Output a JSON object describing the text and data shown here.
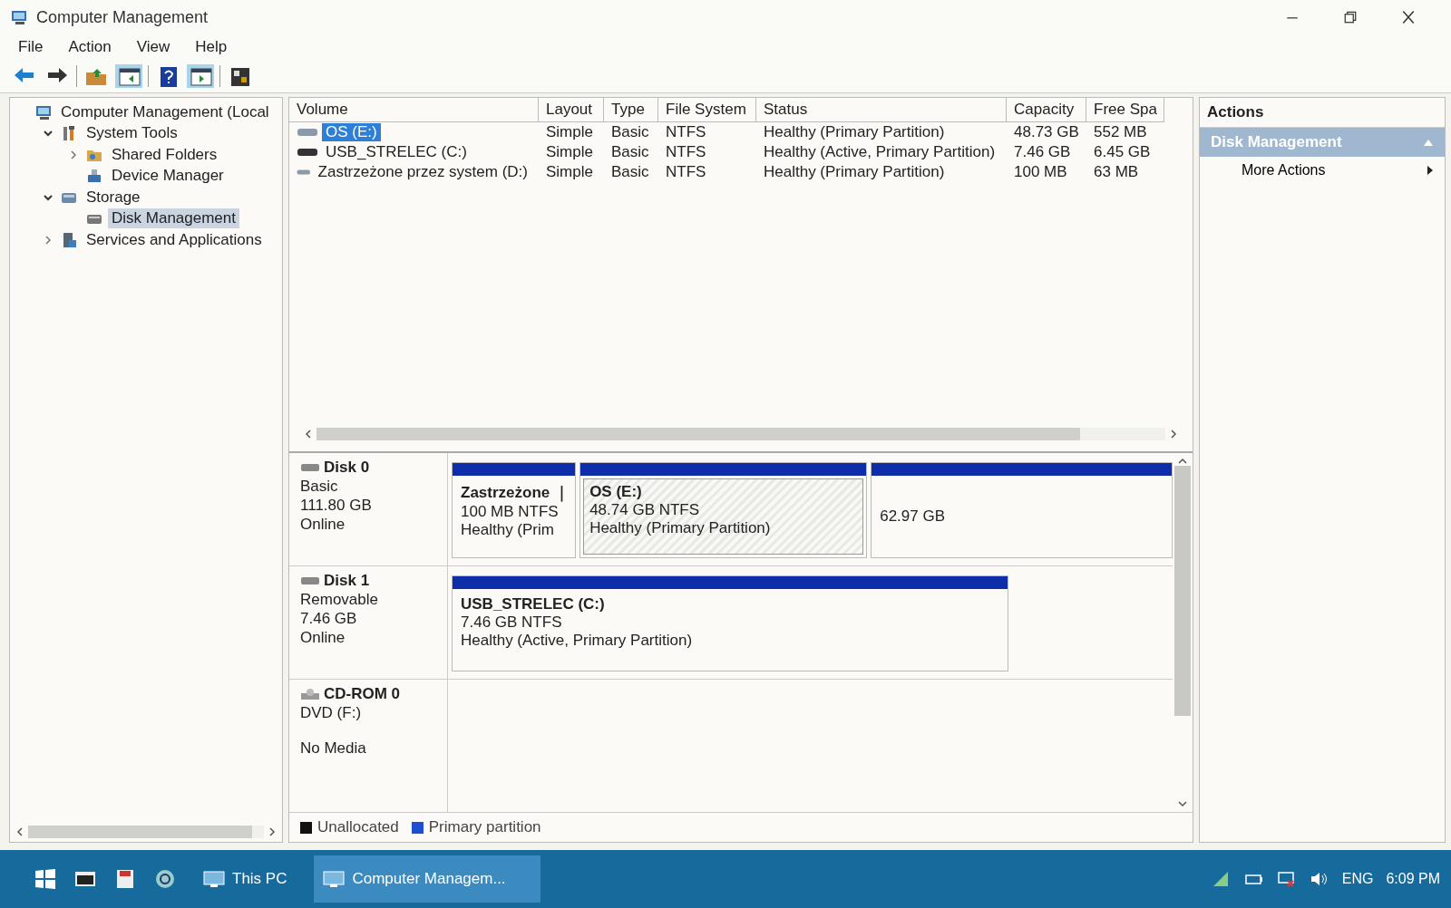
{
  "window": {
    "title": "Computer Management"
  },
  "menu": [
    "File",
    "Action",
    "View",
    "Help"
  ],
  "tree": [
    {
      "label": "Computer Management (Local",
      "selected": false,
      "children": [
        {
          "label": "System Tools",
          "expanded": true,
          "selected": false,
          "children": [
            {
              "label": "Shared Folders",
              "expanded": false,
              "selected": false
            },
            {
              "label": "Device Manager",
              "selected": false
            }
          ]
        },
        {
          "label": "Storage",
          "expanded": true,
          "selected": false,
          "children": [
            {
              "label": "Disk Management",
              "selected": true
            }
          ]
        },
        {
          "label": "Services and Applications",
          "expanded": false,
          "selected": false
        }
      ]
    }
  ],
  "volumes": {
    "columns": [
      "Volume",
      "Layout",
      "Type",
      "File System",
      "Status",
      "Capacity",
      "Free Spa"
    ],
    "rows": [
      {
        "selected": true,
        "cells": [
          "OS (E:)",
          "Simple",
          "Basic",
          "NTFS",
          "Healthy (Primary Partition)",
          "48.73 GB",
          "552 MB"
        ]
      },
      {
        "selected": false,
        "cells": [
          "USB_STRELEC (C:)",
          "Simple",
          "Basic",
          "NTFS",
          "Healthy (Active, Primary Partition)",
          "7.46 GB",
          "6.45 GB"
        ]
      },
      {
        "selected": false,
        "cells": [
          "Zastrzeżone przez system (D:)",
          "Simple",
          "Basic",
          "NTFS",
          "Healthy (Primary Partition)",
          "100 MB",
          "63 MB"
        ]
      }
    ]
  },
  "disks": [
    {
      "name": "Disk 0",
      "kind": "disk",
      "lines": [
        "Basic",
        "111.80 GB",
        "Online"
      ],
      "partitions": [
        {
          "selected": false,
          "lines": [
            "Zastrzeżone ｜",
            "100 MB NTFS",
            "Healthy (Prim"
          ]
        },
        {
          "selected": true,
          "lines": [
            "OS  (E:)",
            "48.74 GB NTFS",
            "Healthy (Primary Partition)"
          ]
        },
        {
          "selected": false,
          "lines": [
            "62.97 GB"
          ]
        }
      ]
    },
    {
      "name": "Disk 1",
      "kind": "disk",
      "lines": [
        "Removable",
        "7.46 GB",
        "Online"
      ],
      "partitions": [
        {
          "selected": false,
          "lines": [
            "USB_STRELEC  (C:)",
            "7.46 GB NTFS",
            "Healthy (Active, Primary Partition)"
          ]
        }
      ]
    },
    {
      "name": "CD-ROM 0",
      "kind": "cdrom",
      "lines": [
        "DVD (F:)",
        "No Media"
      ]
    }
  ],
  "legend": [
    {
      "label": "Unallocated",
      "color": "#111111"
    },
    {
      "label": "Primary partition",
      "color": "#1f4fd0"
    }
  ],
  "actions": {
    "title": "Actions",
    "items": [
      {
        "label": "Disk Management",
        "kind": "header"
      },
      {
        "label": "More Actions",
        "kind": "item"
      }
    ]
  },
  "taskbar": {
    "items": [
      {
        "label": "This PC",
        "selected": false
      },
      {
        "label": "Computer Managem...",
        "selected": true
      }
    ],
    "language": "ENG",
    "time": "6:09 PM"
  }
}
